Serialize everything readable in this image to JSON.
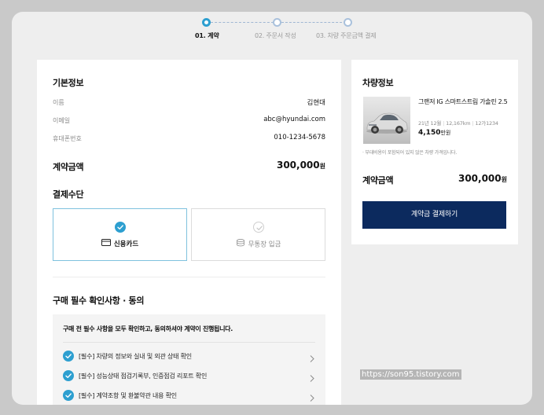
{
  "stepper": {
    "steps": [
      {
        "label": "01. 계약",
        "state": "active"
      },
      {
        "label": "02. 주문서 작성",
        "state": "inactive"
      },
      {
        "label": "03. 차량 주문금액 결제",
        "state": "inactive"
      }
    ]
  },
  "basic_info": {
    "title": "기본정보",
    "rows": [
      {
        "label": "이름",
        "value": "김현대"
      },
      {
        "label": "이메일",
        "value": "abc@hyundai.com"
      },
      {
        "label": "휴대폰번호",
        "value": "010-1234-5678"
      }
    ]
  },
  "contract_amount": {
    "label": "계약금액",
    "value": "300,000",
    "unit": "원"
  },
  "payment_method": {
    "title": "결제수단",
    "options": [
      {
        "label": "신용카드",
        "icon": "credit-card-icon",
        "selected": true
      },
      {
        "label": "무통장 입금",
        "icon": "coins-icon",
        "selected": false
      }
    ]
  },
  "agreements": {
    "title": "구매 필수 확인사항 · 동의",
    "notice": "구매 전 필수 사항을 모두 확인하고, 동의하셔야 계약이 진행됩니다.",
    "items": [
      {
        "label": "[필수] 차량의 정보와 실내 및 외관 상태 확인"
      },
      {
        "label": "[필수] 성능상태 점검기록부, 인증점검 리포트 확인"
      },
      {
        "label": "[필수] 계약조항 및 환불약관 내용 확인"
      }
    ]
  },
  "vehicle": {
    "title": "차량정보",
    "name": "그랜저 IG 스마트스트림 가솔린 2.5",
    "specs": [
      "21년 12월",
      "12,167km",
      "12가1234"
    ],
    "price": "4,150",
    "price_unit": "만원",
    "note": "· 부대비용이 포함되어 있지 않은 차량 가격입니다.",
    "amount_label": "계약금액",
    "amount_value": "300,000",
    "amount_unit": "원",
    "pay_button": "계약금 결제하기"
  },
  "colors": {
    "accent": "#2d9fd0",
    "primary_button": "#0c2a5e",
    "background": "#eeeeee"
  },
  "watermark": "https://son95.tistory.com"
}
